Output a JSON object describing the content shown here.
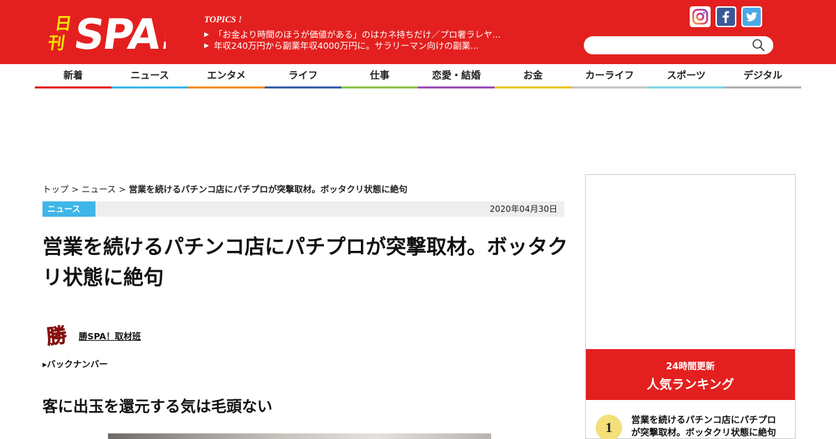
{
  "header": {
    "logo_text": "日刊SPA!",
    "topics_label": "TOPICS !",
    "topics": [
      "「お金より時間のほうが価値がある」のはカネ持ちだけ／プロ奢ラレヤ...",
      "年収240万円から副業年収4000万円に。サラリーマン向けの副業..."
    ],
    "social": [
      "instagram-icon",
      "facebook-icon",
      "twitter-icon"
    ],
    "search_placeholder": ""
  },
  "nav": [
    {
      "label": "新着",
      "color": "#e3201f"
    },
    {
      "label": "ニュース",
      "color": "#3fb6e8"
    },
    {
      "label": "エンタメ",
      "color": "#f0912a"
    },
    {
      "label": "ライフ",
      "color": "#3b5fa8"
    },
    {
      "label": "仕事",
      "color": "#8bc34a"
    },
    {
      "label": "恋愛・結婚",
      "color": "#9c4fb8"
    },
    {
      "label": "お金",
      "color": "#e8c520"
    },
    {
      "label": "カーライフ",
      "color": "#c4c4c4"
    },
    {
      "label": "スポーツ",
      "color": "#7fd4e0"
    },
    {
      "label": "デジタル",
      "color": "#b0b0b0"
    }
  ],
  "breadcrumb": {
    "top": "トップ",
    "sep": ">",
    "category": "ニュース",
    "current": "営業を続けるパチンコ店にパチプロが突撃取材。ボッタクリ状態に絶句"
  },
  "article": {
    "category": "ニュース",
    "date": "2020年04月30日",
    "title": "営業を続けるパチンコ店にパチプロが突撃取材。ボッタクリ状態に絶句",
    "author_icon_text": "勝",
    "author": "勝SPA！取材班",
    "backnumber": "▸バックナンバー",
    "subheading": "客に出玉を還元する気は毛頭ない"
  },
  "sidebar": {
    "ranking_sub": "24時間更新",
    "ranking_title": "人気ランキング",
    "items": [
      {
        "rank": "1",
        "title": "営業を続けるパチンコ店にパチプロが突撃取材。ボッタクリ状態に絶句"
      }
    ]
  },
  "colors": {
    "brand": "#e3201f",
    "category": "#3fb6e8",
    "rank_badge": "#f3e07a"
  }
}
